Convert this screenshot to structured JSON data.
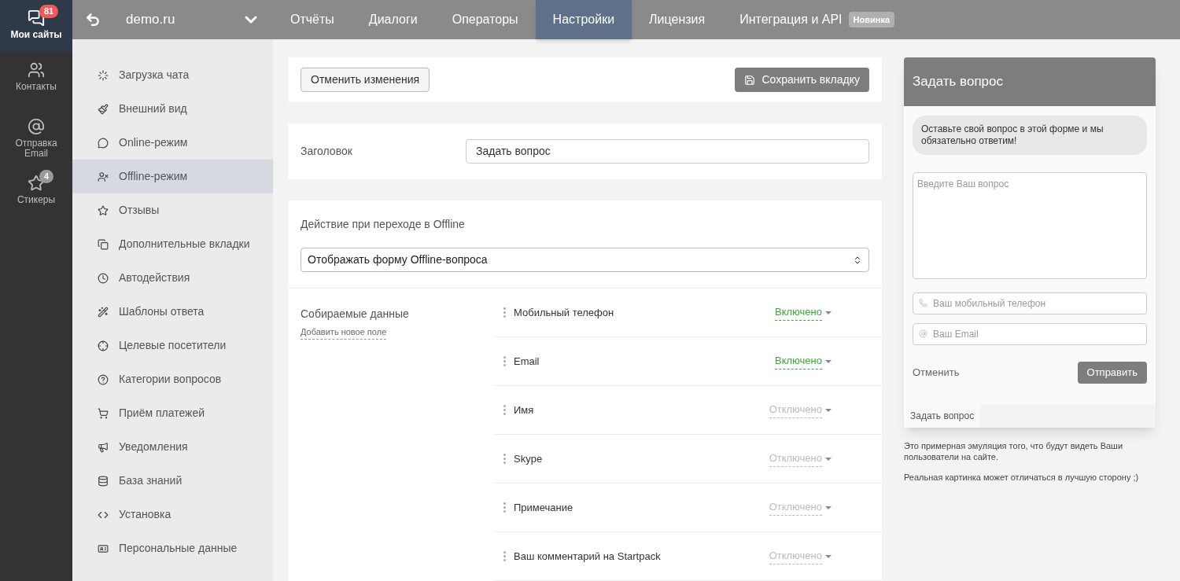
{
  "rail": [
    {
      "label": "Мои сайты",
      "selected": true,
      "badge": {
        "text": "81",
        "color": "#f05a5a"
      }
    },
    {
      "label": "Контакты",
      "selected": false
    },
    {
      "label": "Отправка Email",
      "selected": false
    },
    {
      "label": "Стикеры",
      "selected": false,
      "badge": {
        "text": "4",
        "color": "#9a9a9a"
      }
    }
  ],
  "site": "demo.ru",
  "tabs": [
    {
      "label": "Отчёты",
      "selected": false
    },
    {
      "label": "Диалоги",
      "selected": false
    },
    {
      "label": "Операторы",
      "selected": false
    },
    {
      "label": "Настройки",
      "selected": true
    },
    {
      "label": "Лицензия",
      "selected": false
    },
    {
      "label": "Интеграция и API",
      "selected": false,
      "badge": "Новинка"
    }
  ],
  "sidebar": {
    "items": [
      {
        "label": "Загрузка чата",
        "selected": false
      },
      {
        "label": "Внешний вид",
        "selected": false
      },
      {
        "label": "Online-режим",
        "selected": false
      },
      {
        "label": "Offline-режим",
        "selected": true
      },
      {
        "label": "Отзывы",
        "selected": false
      },
      {
        "label": "Дополнительные вкладки",
        "selected": false
      },
      {
        "label": "Автодействия",
        "selected": false
      },
      {
        "label": "Шаблоны ответа",
        "selected": false
      },
      {
        "label": "Целевые посетители",
        "selected": false
      },
      {
        "label": "Категории вопросов",
        "selected": false
      },
      {
        "label": "Приём платежей",
        "selected": false
      },
      {
        "label": "Уведомления",
        "selected": false
      },
      {
        "label": "База знаний",
        "selected": false
      },
      {
        "label": "Установка",
        "selected": false
      },
      {
        "label": "Персональные данные",
        "selected": false
      }
    ]
  },
  "toolbar": {
    "cancel": "Отменить изменения",
    "save": "Сохранить вкладку"
  },
  "title_field": {
    "label": "Заголовок",
    "value": "Задать вопрос"
  },
  "offline_action": {
    "label": "Действие при переходе в Offline",
    "value": "Отображать форму Offline-вопроса"
  },
  "collected": {
    "label": "Собираемые данные",
    "add_link": "Добавить новое поле",
    "fields": [
      {
        "name": "Мобильный телефон",
        "enabled": true,
        "status": "Включено"
      },
      {
        "name": "Email",
        "enabled": true,
        "status": "Включено"
      },
      {
        "name": "Имя",
        "enabled": false,
        "status": "Отключено"
      },
      {
        "name": "Skype",
        "enabled": false,
        "status": "Отключено"
      },
      {
        "name": "Примечание",
        "enabled": false,
        "status": "Отключено"
      },
      {
        "name": "Ваш комментарий на Startpack",
        "enabled": false,
        "status": "Отключено"
      }
    ]
  },
  "preview": {
    "title": "Задать вопрос",
    "message": "Оставьте свой вопрос в этой форме и мы обязательно ответим!",
    "question_placeholder": "Введите Ваш вопрос",
    "phone_placeholder": "Ваш мобильный телефон",
    "email_placeholder": "Ваш Email",
    "cancel": "Отменить",
    "send": "Отправить",
    "tab": "Задать вопрос",
    "notes": [
      "Это примерная эмуляция того, что будут видеть Ваши пользователи на сайте.",
      "Реальная картинка может отличаться в лучшую сторону ;)"
    ]
  }
}
